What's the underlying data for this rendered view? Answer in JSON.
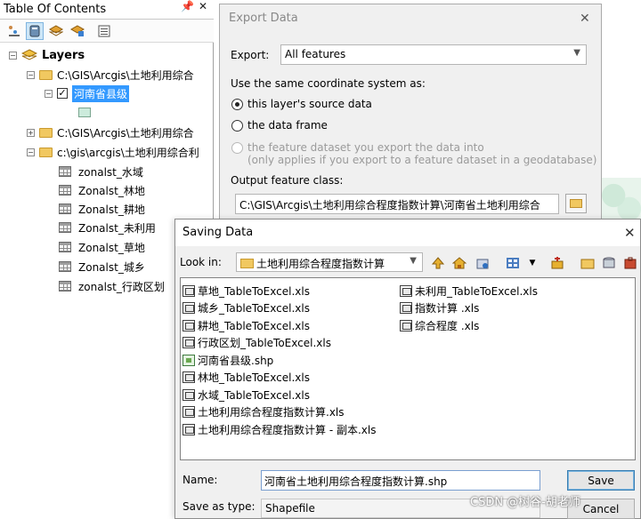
{
  "toc": {
    "title": "Table Of Contents",
    "pin_icon": "pin-icon",
    "close_icon": "close-icon",
    "root": "Layers",
    "items": [
      {
        "label": "C:\\GIS\\Arcgis\\土地利用综合"
      },
      {
        "label": "河南省县级"
      },
      {
        "label": "C:\\GIS\\Arcgis\\土地利用综合"
      },
      {
        "label": "c:\\gis\\arcgis\\土地利用综合利"
      }
    ],
    "tables": [
      "zonalst_水域",
      "Zonalst_林地",
      "Zonalst_耕地",
      "Zonalst_未利用",
      "Zonalst_草地",
      "Zonalst_城乡",
      "zonalst_行政区划"
    ]
  },
  "export": {
    "title": "Export Data",
    "export_label": "Export:",
    "export_value": "All features",
    "coord_label": "Use the same coordinate system as:",
    "opt1": "this layer's source data",
    "opt2": "the data frame",
    "opt3_line1": "the feature dataset you export the data into",
    "opt3_line2": "(only applies if you export to a feature dataset in a geodatabase)",
    "output_label": "Output feature class:",
    "output_value": "C:\\GIS\\Arcgis\\土地利用综合程度指数计算\\河南省土地利用综合"
  },
  "saving": {
    "title": "Saving Data",
    "look_in_label": "Look in:",
    "look_in_value": "土地利用综合程度指数计算",
    "files_col1": [
      {
        "name": "草地_TableToExcel.xls",
        "type": "xls"
      },
      {
        "name": "城乡_TableToExcel.xls",
        "type": "xls"
      },
      {
        "name": "耕地_TableToExcel.xls",
        "type": "xls"
      },
      {
        "name": "行政区划_TableToExcel.xls",
        "type": "xls"
      },
      {
        "name": "河南省县级.shp",
        "type": "shp"
      },
      {
        "name": "林地_TableToExcel.xls",
        "type": "xls"
      },
      {
        "name": "水域_TableToExcel.xls",
        "type": "xls"
      },
      {
        "name": "土地利用综合程度指数计算.xls",
        "type": "xls"
      },
      {
        "name": "土地利用综合程度指数计算 - 副本.xls",
        "type": "xls"
      }
    ],
    "files_col2": [
      {
        "name": "未利用_TableToExcel.xls",
        "type": "xls"
      },
      {
        "name": "指数计算 .xls",
        "type": "xls"
      },
      {
        "name": "综合程度 .xls",
        "type": "xls"
      }
    ],
    "name_label": "Name:",
    "name_value": "河南省土地利用综合程度指数计算.shp",
    "type_label": "Save as type:",
    "type_value": "Shapefile",
    "save_label": "Save",
    "cancel_label": "Cancel"
  },
  "watermark": "CSDN @树谷-胡老师"
}
